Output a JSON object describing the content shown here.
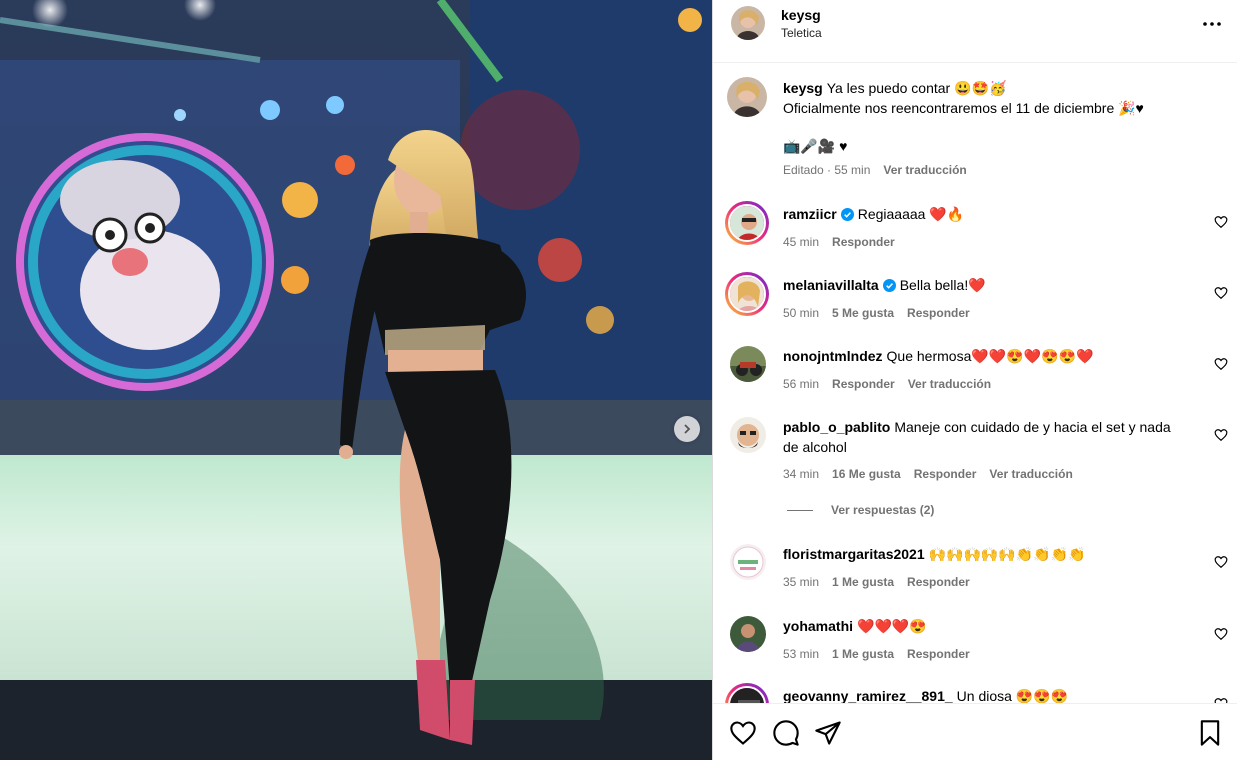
{
  "post": {
    "username": "keysg",
    "location": "Teletica",
    "caption_user": "keysg",
    "caption_line1": "Ya les puedo contar 😃🤩🥳",
    "caption_line2": "Oficialmente nos reencontraremos el 11 de diciembre 🎉♥",
    "caption_line3": "📺🎤🎥 ♥",
    "caption_time": "Editado · 55 min",
    "caption_translate": "Ver traducción"
  },
  "comments": [
    {
      "user": "ramziicr",
      "verified": true,
      "text": "Regiaaaaa ❤️🔥",
      "time": "45 min",
      "likes": "",
      "reply": "Responder",
      "translate": ""
    },
    {
      "user": "melaniavillalta",
      "verified": true,
      "text": "Bella bella!❤️",
      "time": "50 min",
      "likes": "5 Me gusta",
      "reply": "Responder",
      "translate": ""
    },
    {
      "user": "nonojntmlndez",
      "verified": false,
      "text": "Que hermosa❤️❤️😍❤️😍😍❤️",
      "time": "56 min",
      "likes": "",
      "reply": "Responder",
      "translate": "Ver traducción"
    },
    {
      "user": "pablo_o_pablito",
      "verified": false,
      "text": "Maneje con cuidado de y hacia el set y nada",
      "text2": "de alcohol",
      "time": "34 min",
      "likes": "16 Me gusta",
      "reply": "Responder",
      "translate": "Ver traducción",
      "view_replies": "Ver respuestas (2)"
    },
    {
      "user": "floristmargaritas2021",
      "verified": false,
      "text": "🙌🙌🙌🙌🙌👏👏👏👏",
      "time": "35 min",
      "likes": "1 Me gusta",
      "reply": "Responder",
      "translate": ""
    },
    {
      "user": "yohamathi",
      "verified": false,
      "text": "❤️❤️❤️😍",
      "time": "53 min",
      "likes": "1 Me gusta",
      "reply": "Responder",
      "translate": ""
    },
    {
      "user": "geovanny_ramirez__891_",
      "verified": false,
      "text": "Un diosa 😍😍😍",
      "time": "",
      "likes": "",
      "reply": "",
      "translate": ""
    }
  ],
  "icons": {
    "more": "more-options-icon",
    "like": "heart-icon",
    "comment": "comment-icon",
    "share": "share-icon",
    "save": "bookmark-icon",
    "next": "chevron-right-icon",
    "verified": "verified-badge-icon"
  },
  "colors": {
    "verified": "#0095f6",
    "muted": "#737373",
    "border": "#dbdbdb",
    "story_ring": "#d300c5"
  }
}
